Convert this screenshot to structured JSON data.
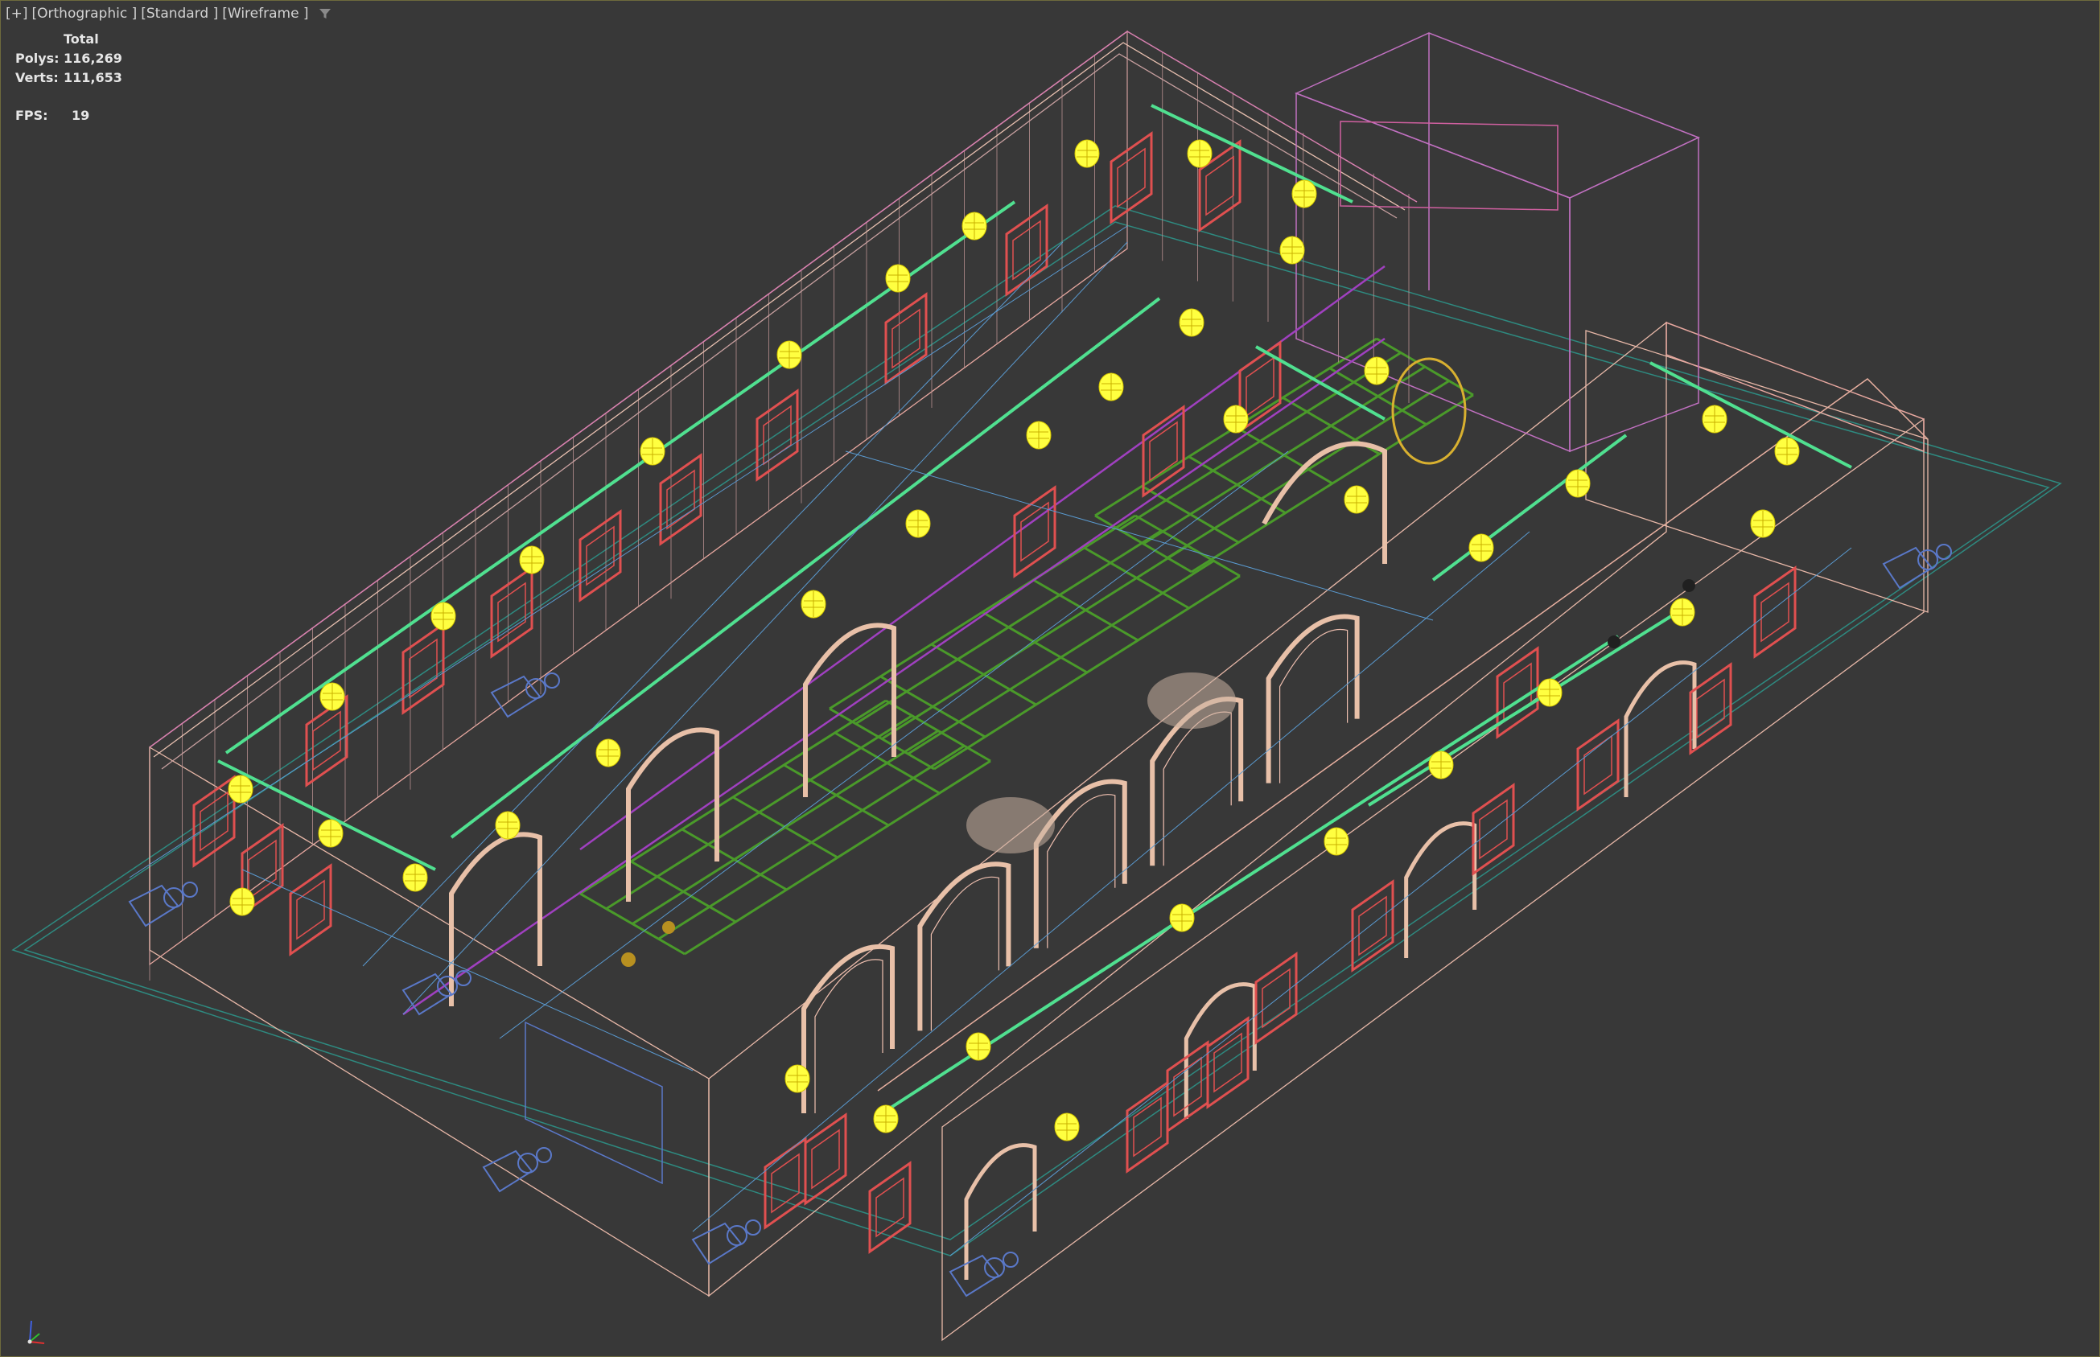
{
  "viewport": {
    "menu_plus": "[+]",
    "view_label": "[Orthographic ]",
    "shading_label": "[Standard ]",
    "display_label": "[Wireframe ]",
    "filter_icon": "funnel-icon"
  },
  "stats": {
    "total_header": "Total",
    "polys_label": "Polys:",
    "polys_value": "116,269",
    "verts_label": "Verts:",
    "verts_value": "111,653",
    "fps_label": "FPS:",
    "fps_value": "19"
  },
  "colors": {
    "background": "#383838",
    "wall_wire": "#e8b8a8",
    "outline_magenta": "#c070c0",
    "frame_red": "#e05050",
    "light_yellow": "#ffff40",
    "rail_green": "#50e090",
    "grid_green": "#4a9a2a",
    "camera_blue": "#5a78c8",
    "ground_teal": "#2e8a80"
  },
  "gizmo": {
    "icon": "axis-tripod-icon"
  }
}
